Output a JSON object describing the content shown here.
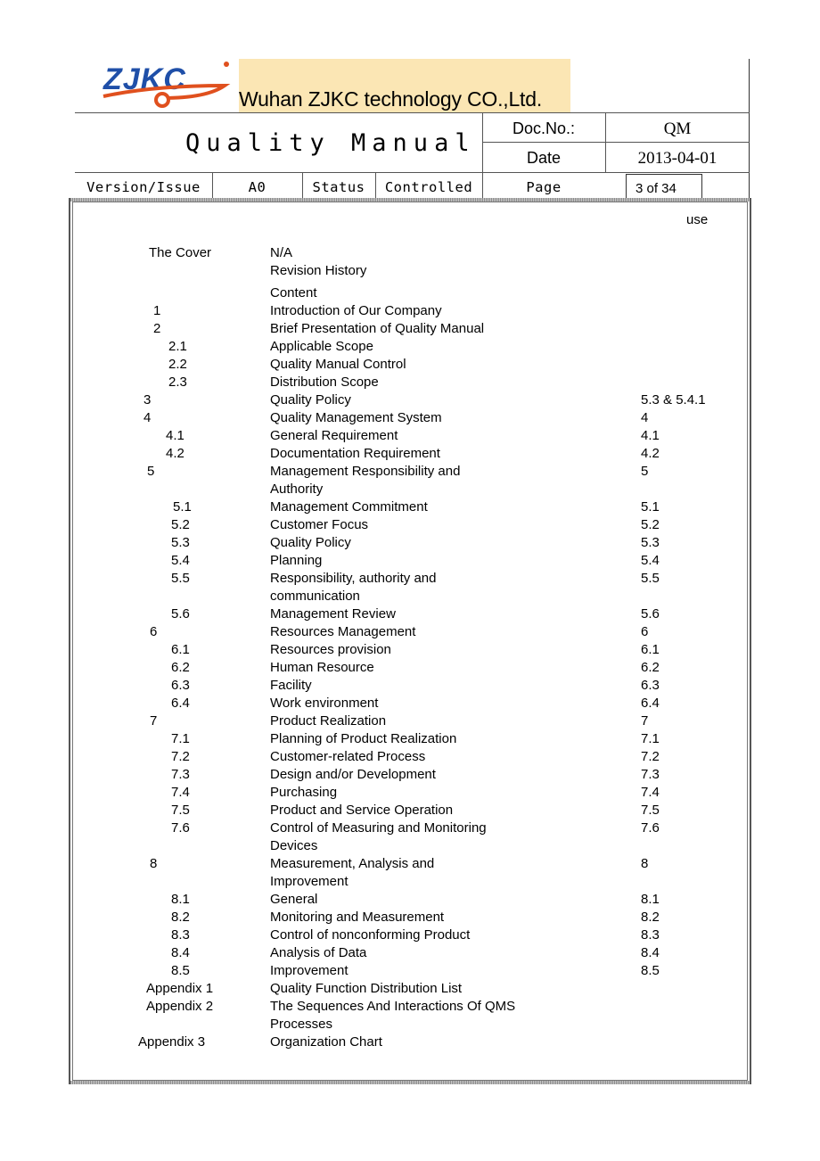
{
  "header": {
    "company_name": "Wuhan ZJKC technology CO.,Ltd.",
    "logo_text": "ZJKC",
    "document_title": "Quality Manual",
    "doc_no_label": "Doc.No.:",
    "doc_no_value": "QM",
    "date_label": "Date",
    "date_value": "2013-04-01",
    "version_label": "Version/Issue",
    "version_value": "A0",
    "status_label": "Status",
    "status_value": "Controlled",
    "page_label": "Page",
    "page_value": "3 of 34"
  },
  "colors": {
    "logo_blue": "#1f4fa8",
    "logo_orange": "#e0501e",
    "banner_bg": "#fbe6b4"
  },
  "toc": {
    "column_header_ref": "use",
    "rows": [
      {
        "num": "The Cover",
        "title": "N/A",
        "ref": ""
      },
      {
        "num": "",
        "title": "Revision History",
        "ref": ""
      },
      {
        "num": "",
        "title": "Content",
        "ref": ""
      },
      {
        "num": "1",
        "title": "Introduction of Our Company",
        "ref": ""
      },
      {
        "num": "2",
        "title": "Brief Presentation of Quality Manual",
        "ref": ""
      },
      {
        "num": "2.1",
        "title": "Applicable Scope",
        "ref": ""
      },
      {
        "num": "2.2",
        "title": "Quality Manual Control",
        "ref": ""
      },
      {
        "num": "2.3",
        "title": "Distribution Scope",
        "ref": ""
      },
      {
        "num": "3",
        "title": "Quality Policy",
        "ref": "5.3 & 5.4.1"
      },
      {
        "num": "4",
        "title": "Quality Management System",
        "ref": "4"
      },
      {
        "num": "4.1",
        "title": "General Requirement",
        "ref": "4.1"
      },
      {
        "num": "4.2",
        "title": "Documentation Requirement",
        "ref": "4.2"
      },
      {
        "num": "5",
        "title": "Management Responsibility and",
        "ref": "5"
      },
      {
        "num": "",
        "title": "Authority",
        "ref": ""
      },
      {
        "num": "5.1",
        "title": "Management Commitment",
        "ref": "5.1"
      },
      {
        "num": "5.2",
        "title": "Customer Focus",
        "ref": "5.2"
      },
      {
        "num": "5.3",
        "title": "Quality Policy",
        "ref": "5.3"
      },
      {
        "num": "5.4",
        "title": "Planning",
        "ref": "5.4"
      },
      {
        "num": "5.5",
        "title": "Responsibility, authority and",
        "ref": "5.5"
      },
      {
        "num": "",
        "title": "communication",
        "ref": ""
      },
      {
        "num": "5.6",
        "title": "Management Review",
        "ref": "5.6"
      },
      {
        "num": "6",
        "title": "Resources Management",
        "ref": "6"
      },
      {
        "num": "6.1",
        "title": "Resources provision",
        "ref": "6.1"
      },
      {
        "num": "6.2",
        "title": "Human Resource",
        "ref": "6.2"
      },
      {
        "num": "6.3",
        "title": "Facility",
        "ref": "6.3"
      },
      {
        "num": "6.4",
        "title": "Work environment",
        "ref": "6.4"
      },
      {
        "num": "7",
        "title": "Product Realization",
        "ref": "7"
      },
      {
        "num": "7.1",
        "title": "Planning of Product Realization",
        "ref": "7.1"
      },
      {
        "num": "7.2",
        "title": "Customer-related Process",
        "ref": "7.2"
      },
      {
        "num": "7.3",
        "title": "Design and/or Development",
        "ref": "7.3"
      },
      {
        "num": "7.4",
        "title": "Purchasing",
        "ref": "7.4"
      },
      {
        "num": "7.5",
        "title": "Product and Service Operation",
        "ref": "7.5"
      },
      {
        "num": "7.6",
        "title": "Control of Measuring and Monitoring",
        "ref": "7.6"
      },
      {
        "num": "",
        "title": "Devices",
        "ref": ""
      },
      {
        "num": "8",
        "title": "Measurement, Analysis and",
        "ref": "8"
      },
      {
        "num": "",
        "title": "Improvement",
        "ref": ""
      },
      {
        "num": "8.1",
        "title": "General",
        "ref": "8.1"
      },
      {
        "num": "8.2",
        "title": "Monitoring and Measurement",
        "ref": "8.2"
      },
      {
        "num": "8.3",
        "title": "Control of nonconforming Product",
        "ref": "8.3"
      },
      {
        "num": "8.4",
        "title": "Analysis of Data",
        "ref": "8.4"
      },
      {
        "num": "8.5",
        "title": "Improvement",
        "ref": "8.5"
      },
      {
        "num": "Appendix 1",
        "title": "Quality Function Distribution List",
        "ref": ""
      },
      {
        "num": "Appendix 2",
        "title": "The Sequences And Interactions Of QMS",
        "ref": ""
      },
      {
        "num": "",
        "title": "Processes",
        "ref": ""
      },
      {
        "num": "Appendix 3",
        "title": "Organization Chart",
        "ref": ""
      }
    ]
  }
}
